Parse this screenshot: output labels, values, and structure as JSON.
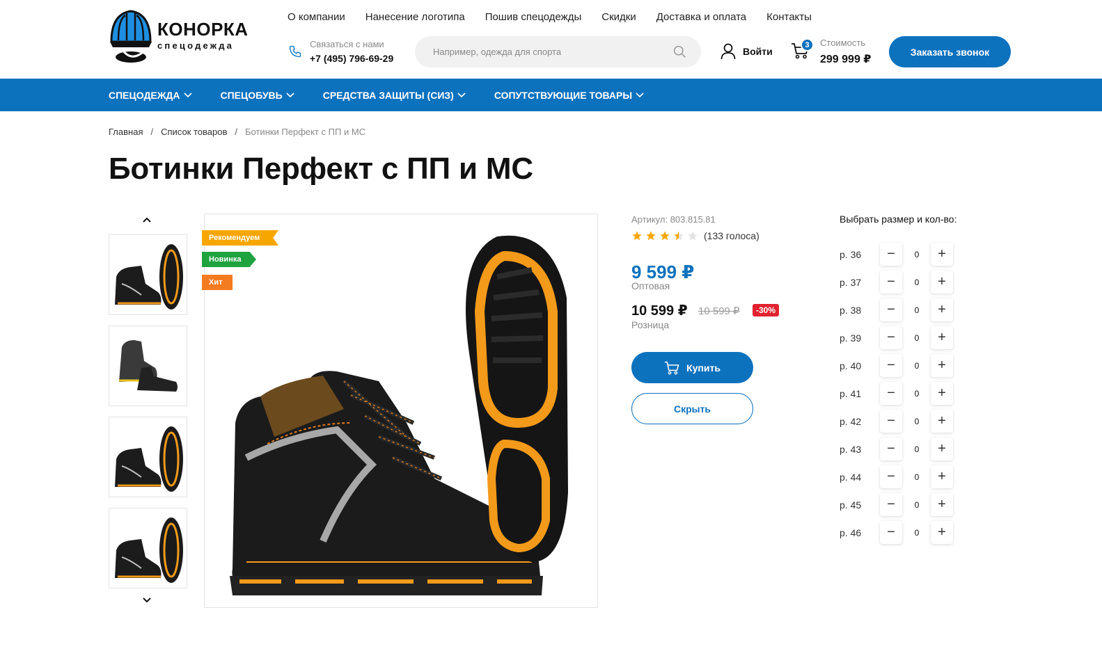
{
  "brand": {
    "name": "КОНОРКА",
    "tagline": "спецодежда"
  },
  "topnav": [
    "О компании",
    "Нанесение логотипа",
    "Пошив спецодежды",
    "Скидки",
    "Доставка и оплата",
    "Контакты"
  ],
  "contact": {
    "label": "Связаться с нами",
    "phone": "+7 (495) 796-69-29"
  },
  "search": {
    "placeholder": "Например, одежда для спорта",
    "value": ""
  },
  "login": {
    "label": "Войти"
  },
  "cart": {
    "count": "3",
    "label": "Стоимость",
    "total": "299 999 ₽"
  },
  "callback": {
    "label": "Заказать звонок"
  },
  "menu": [
    "СПЕЦОДЕЖДА",
    "СПЕЦОБУВЬ",
    "СРЕДСТВА ЗАЩИТЫ (СИЗ)",
    "СОПУТСТВУЮЩИЕ ТОВАРЫ"
  ],
  "breadcrumb": {
    "items": [
      "Главная",
      "Список товаров",
      "Ботинки Перфект с ПП и МС"
    ],
    "separator": "/"
  },
  "product": {
    "title": "Ботинки Перфект с ПП и МС",
    "tags": {
      "recommended": "Рекомендуем",
      "new": "Новинка",
      "hit": "Хит"
    },
    "sku": "Артикул: 803.815.81",
    "rating": 3.5,
    "votes": "(133 голоса)",
    "wholesale_price": "9 599 ₽",
    "wholesale_label": "Оптовая",
    "retail_price": "10 599 ₽",
    "old_price": "10 599 ₽",
    "discount": "-30%",
    "retail_label": "Розница",
    "buy_label": "Купить",
    "hide_label": "Скрыть"
  },
  "sizes": {
    "title": "Выбрать размер и кол-во:",
    "items": [
      {
        "size": "р. 36",
        "qty": "0"
      },
      {
        "size": "р. 37",
        "qty": "0"
      },
      {
        "size": "р. 38",
        "qty": "0"
      },
      {
        "size": "р. 39",
        "qty": "0"
      },
      {
        "size": "р. 40",
        "qty": "0"
      },
      {
        "size": "р. 41",
        "qty": "0"
      },
      {
        "size": "р. 42",
        "qty": "0"
      },
      {
        "size": "р. 43",
        "qty": "0"
      },
      {
        "size": "р. 44",
        "qty": "0"
      },
      {
        "size": "р. 45",
        "qty": "0"
      },
      {
        "size": "р. 46",
        "qty": "0"
      }
    ],
    "minus": "−",
    "plus": "+"
  },
  "colors": {
    "brand_blue": "#0d72be",
    "tag_orange": "#f7a600",
    "tag_green": "#1fa33f",
    "tag_hit": "#f47b20",
    "discount_red": "#e1232f"
  }
}
